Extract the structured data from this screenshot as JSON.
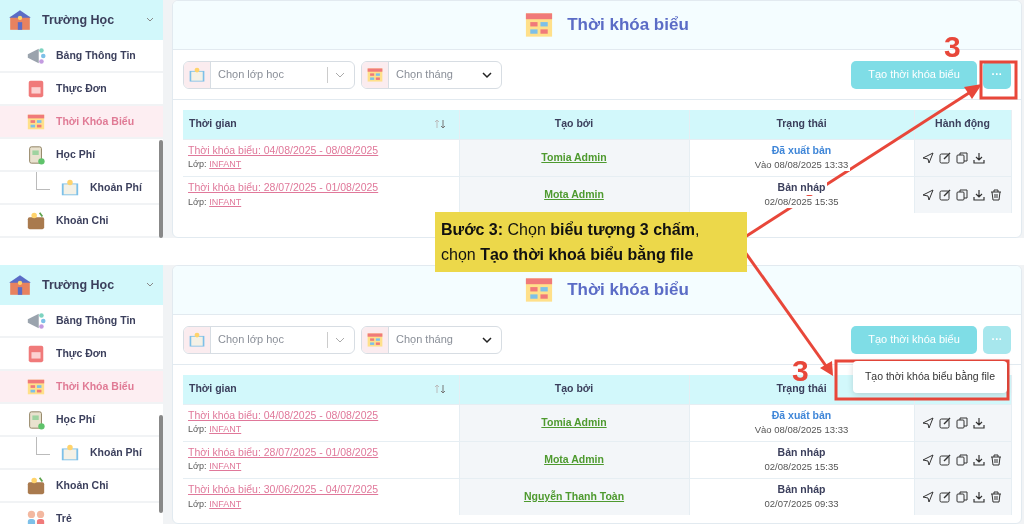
{
  "screens": [
    {
      "sidebar": {
        "header": "Trường Học",
        "expanded": true,
        "items": [
          {
            "label": "Bảng Thông Tin",
            "selected": false
          },
          {
            "label": "Thực Đơn",
            "selected": false
          },
          {
            "label": "Thời Khóa Biểu",
            "selected": true
          },
          {
            "label": "Học Phí",
            "selected": false,
            "children": [
              {
                "label": "Khoản Phí",
                "selected": false
              }
            ]
          },
          {
            "label": "Khoản Chi",
            "selected": false
          }
        ]
      },
      "title": "Thời khóa biểu",
      "filters": [
        {
          "kind": "searchable",
          "placeholder": "Chọn lớp học"
        },
        {
          "kind": "native",
          "placeholder": "Chọn tháng"
        }
      ],
      "create_button": "Tạo thời khóa biểu",
      "more_button": "···",
      "more_menu": {
        "open": false
      },
      "step_label": "3",
      "columns": [
        "Thời gian",
        "Tạo bởi",
        "Trạng thái",
        "Hành động"
      ],
      "rows": [
        {
          "period": "Thời khóa biểu: 04/08/2025 - 08/08/2025",
          "class_label": "Lớp:",
          "class_name": "INFANT",
          "creator": "Tomia Admin",
          "status": {
            "kind": "published",
            "text": "Đã xuất bản",
            "time": "Vào 08/08/2025 13:33"
          },
          "deletable": false
        },
        {
          "period": "Thời khóa biểu: 28/07/2025 - 01/08/2025",
          "class_label": "Lớp:",
          "class_name": "INFANT",
          "creator": "Mota Admin",
          "status": {
            "kind": "draft",
            "text": "Bản nháp",
            "time": "02/08/2025 15:35"
          },
          "deletable": true
        }
      ]
    },
    {
      "sidebar": {
        "header": "Trường Học",
        "expanded": true,
        "items": [
          {
            "label": "Bảng Thông Tin",
            "selected": false
          },
          {
            "label": "Thực Đơn",
            "selected": false
          },
          {
            "label": "Thời Khóa Biểu",
            "selected": true
          },
          {
            "label": "Học Phí",
            "selected": false,
            "children": [
              {
                "label": "Khoản Phí",
                "selected": false
              }
            ]
          },
          {
            "label": "Khoản Chi",
            "selected": false
          },
          {
            "label": "Trẻ",
            "selected": false
          }
        ]
      },
      "title": "Thời khóa biểu",
      "filters": [
        {
          "kind": "searchable",
          "placeholder": "Chọn lớp học"
        },
        {
          "kind": "native",
          "placeholder": "Chọn tháng"
        }
      ],
      "create_button": "Tạo thời khóa biểu",
      "more_button": "···",
      "more_menu": {
        "open": true,
        "items": [
          "Tạo thời khóa biểu bằng file"
        ]
      },
      "step_label": "3",
      "columns": [
        "Thời gian",
        "Tạo bởi",
        "Trạng thái"
      ],
      "rows": [
        {
          "period": "Thời khóa biểu: 04/08/2025 - 08/08/2025",
          "class_label": "Lớp:",
          "class_name": "INFANT",
          "creator": "Tomia Admin",
          "status": {
            "kind": "published",
            "text": "Đã xuất bản",
            "time": "Vào 08/08/2025 13:33"
          },
          "deletable": false
        },
        {
          "period": "Thời khóa biểu: 28/07/2025 - 01/08/2025",
          "class_label": "Lớp:",
          "class_name": "INFANT",
          "creator": "Mota Admin",
          "status": {
            "kind": "draft",
            "text": "Bản nháp",
            "time": "02/08/2025 15:35"
          },
          "deletable": true
        },
        {
          "period": "Thời khóa biểu: 30/06/2025 - 04/07/2025",
          "class_label": "Lớp:",
          "class_name": "INFANT",
          "creator": "Nguyễn Thanh Toàn",
          "status": {
            "kind": "draft",
            "text": "Bản nháp",
            "time": "02/07/2025 09:33"
          },
          "deletable": true
        }
      ]
    }
  ],
  "callout": {
    "text": "**Bước 3:** Chọn **biểu tượng 3 chấm**,\nchọn **Tạo thời khoá biểu bằng file**"
  }
}
